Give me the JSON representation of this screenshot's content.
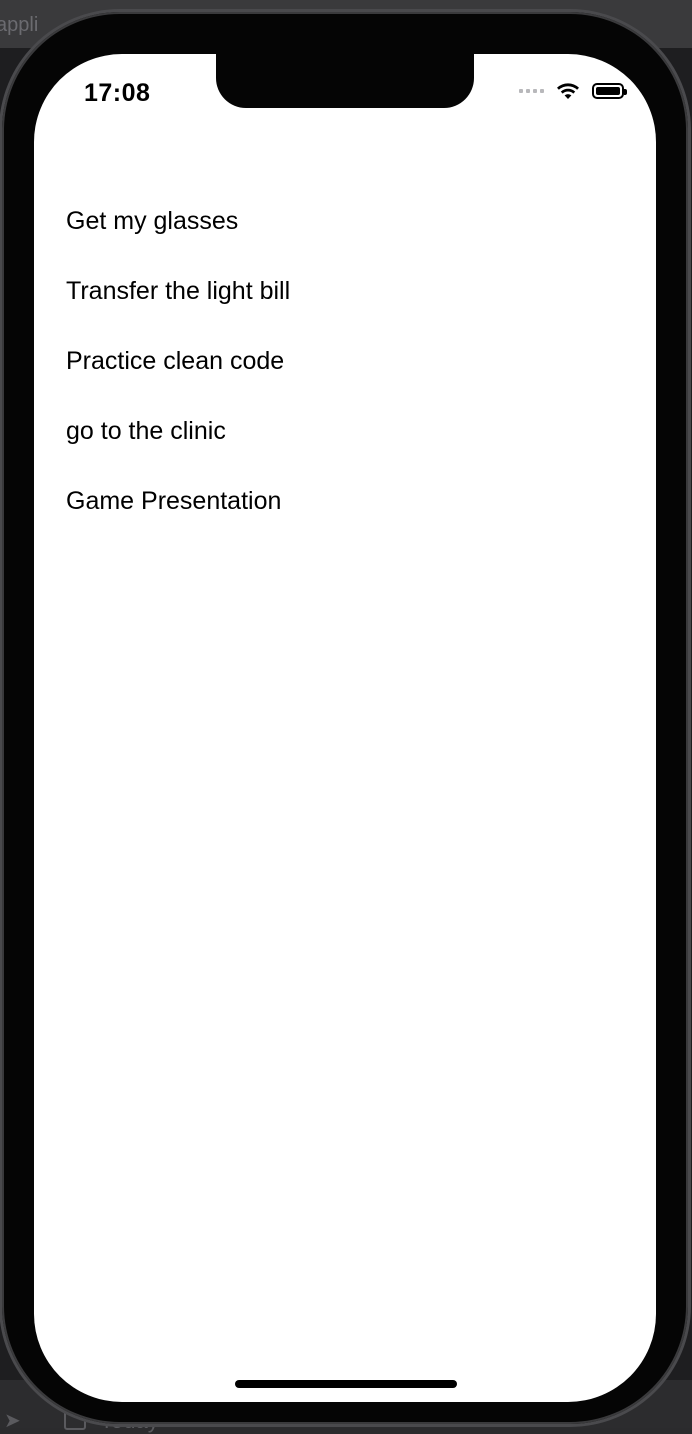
{
  "background": {
    "top_text": "appli",
    "bottom_text": "Today"
  },
  "status_bar": {
    "time": "17:08"
  },
  "tasks": [
    {
      "label": "Get my glasses"
    },
    {
      "label": "Transfer the light bill"
    },
    {
      "label": "Practice clean code"
    },
    {
      "label": "go to the clinic"
    },
    {
      "label": "Game Presentation"
    }
  ],
  "colors": {
    "screen_background": "#ffffff",
    "text": "#000000",
    "frame": "#050505"
  }
}
